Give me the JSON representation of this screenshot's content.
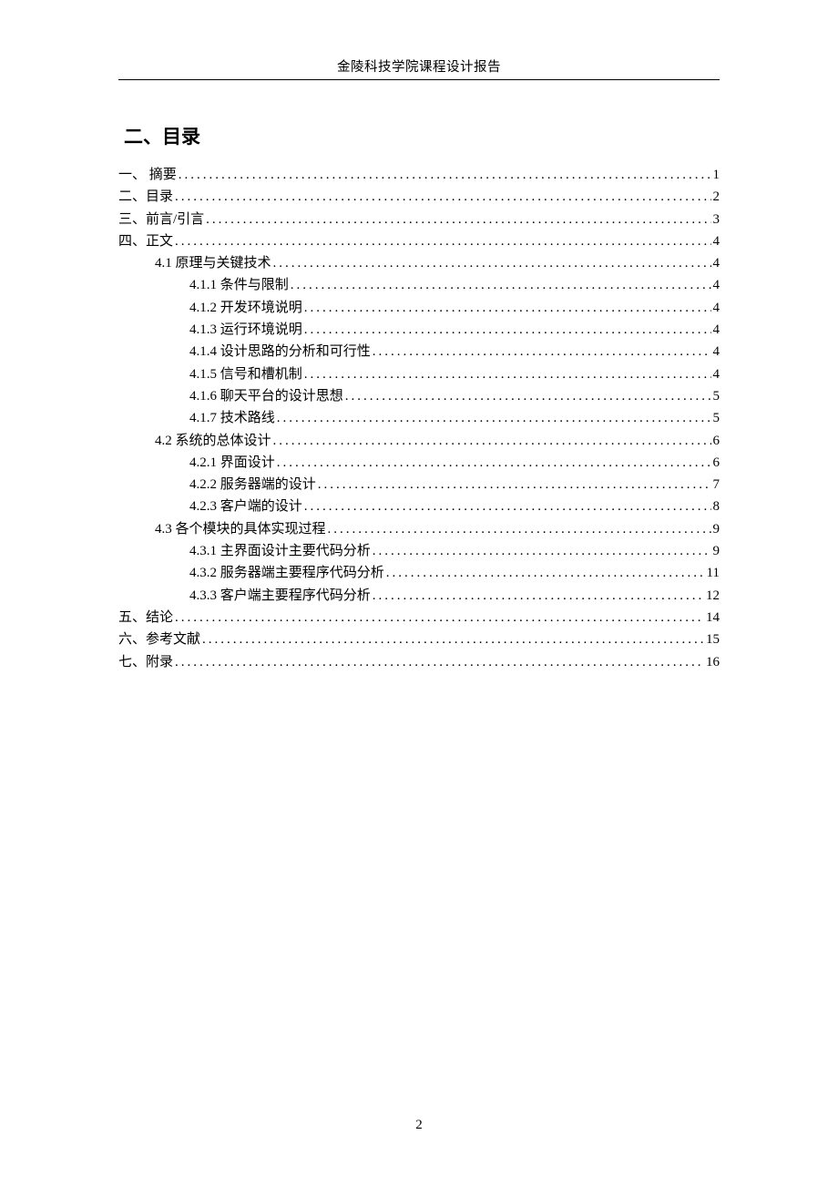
{
  "header": "金陵科技学院课程设计报告",
  "title": "二、目录",
  "page_number": "2",
  "toc": [
    {
      "level": 0,
      "label": "一、 摘要",
      "page": "1"
    },
    {
      "level": 0,
      "label": "二、目录",
      "page": "2"
    },
    {
      "level": 0,
      "label": "三、前言/引言",
      "page": "3"
    },
    {
      "level": 0,
      "label": "四、正文",
      "page": "4"
    },
    {
      "level": 1,
      "label": "4.1 原理与关键技术 ",
      "page": "4"
    },
    {
      "level": 2,
      "label": "4.1.1 条件与限制 ",
      "page": "4"
    },
    {
      "level": 2,
      "label": "4.1.2 开发环境说明 ",
      "page": "4"
    },
    {
      "level": 2,
      "label": "4.1.3 运行环境说明 ",
      "page": "4"
    },
    {
      "level": 2,
      "label": "4.1.4 设计思路的分析和可行性 ",
      "page": "4"
    },
    {
      "level": 2,
      "label": "4.1.5 信号和槽机制 ",
      "page": "4"
    },
    {
      "level": 2,
      "label": "4.1.6 聊天平台的设计思想 ",
      "page": "5"
    },
    {
      "level": 2,
      "label": "4.1.7 技术路线 ",
      "page": "5"
    },
    {
      "level": 1,
      "label": "4.2 系统的总体设计 ",
      "page": "6"
    },
    {
      "level": 2,
      "label": "4.2.1 界面设计 ",
      "page": "6"
    },
    {
      "level": 2,
      "label": "4.2.2 服务器端的设计 ",
      "page": "7"
    },
    {
      "level": 2,
      "label": "4.2.3 客户端的设计 ",
      "page": "8"
    },
    {
      "level": 1,
      "label": "4.3 各个模块的具体实现过程",
      "page": "9"
    },
    {
      "level": 2,
      "label": "4.3.1 主界面设计主要代码分析 ",
      "page": "9"
    },
    {
      "level": 2,
      "label": "4.3.2 服务器端主要程序代码分析 ",
      "page": "11"
    },
    {
      "level": 2,
      "label": "4.3.3 客户端主要程序代码分析 ",
      "page": "12"
    },
    {
      "level": 0,
      "label": "五、结论",
      "page": "14"
    },
    {
      "level": 0,
      "label": "六、参考文献",
      "page": "15"
    },
    {
      "level": 0,
      "label": "七、附录",
      "page": "16"
    }
  ]
}
